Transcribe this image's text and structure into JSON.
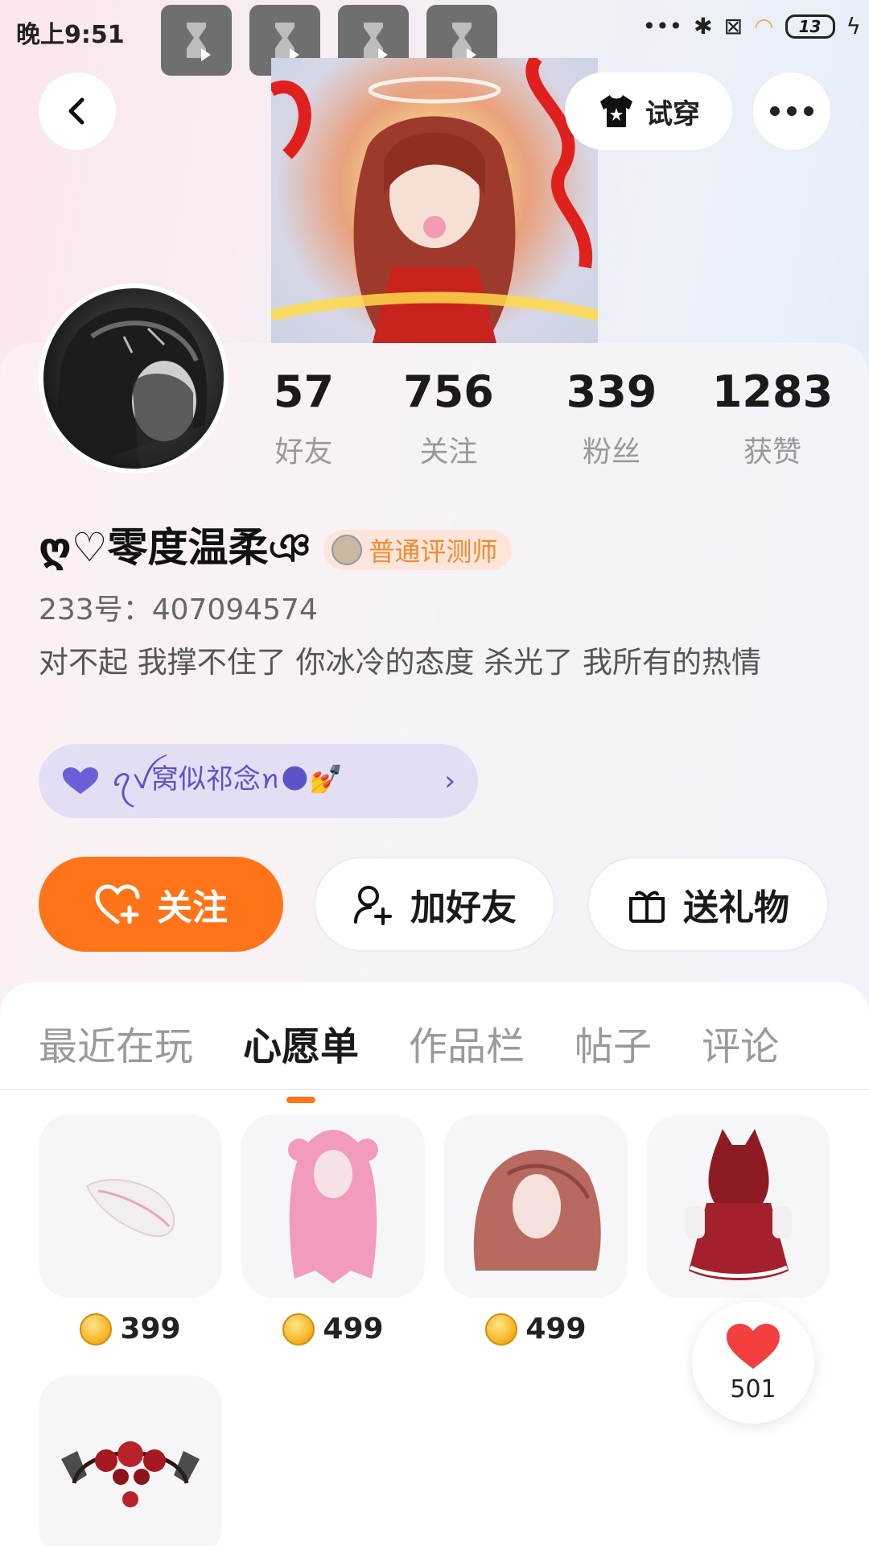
{
  "status_bar": {
    "time": "晚上9:51",
    "battery": "13"
  },
  "header": {
    "back_icon": "chevron-left-icon",
    "tryon_label": "试穿",
    "more_icon": "more-dots-icon"
  },
  "profile": {
    "stats": [
      {
        "num": "57",
        "label": "好友"
      },
      {
        "num": "756",
        "label": "关注"
      },
      {
        "num": "339",
        "label": "粉丝"
      },
      {
        "num": "1283",
        "label": "获赞"
      }
    ],
    "username": "ღ♡零度温柔ঞ",
    "badge": "普通评测师",
    "uid": "233号：407094574",
    "bio": "对不起 我撑不住了 你冰冷的态度 杀光了  我所有的热情",
    "club_text": "ꪖꪜ窝似祁念ꪀ🌑💅"
  },
  "actions": {
    "follow": "关注",
    "add_friend": "加好友",
    "send_gift": "送礼物"
  },
  "tabs": [
    "最近在玩",
    "心愿单",
    "作品栏",
    "帖子",
    "评论"
  ],
  "active_tab": 1,
  "wishlist": [
    {
      "name": "white-feather-wing",
      "price": "399"
    },
    {
      "name": "pink-twin-hair",
      "price": "499"
    },
    {
      "name": "auburn-long-hair",
      "price": "499"
    },
    {
      "name": "red-hood-dress",
      "price": ""
    },
    {
      "name": "red-flower-butterfly-headband",
      "price": ""
    }
  ],
  "like_fab": {
    "count": "501"
  },
  "colors": {
    "accent": "#ff7419",
    "club_bg": "#e4def4",
    "club_text": "#5b54c9",
    "badge_text": "#f08a34"
  }
}
